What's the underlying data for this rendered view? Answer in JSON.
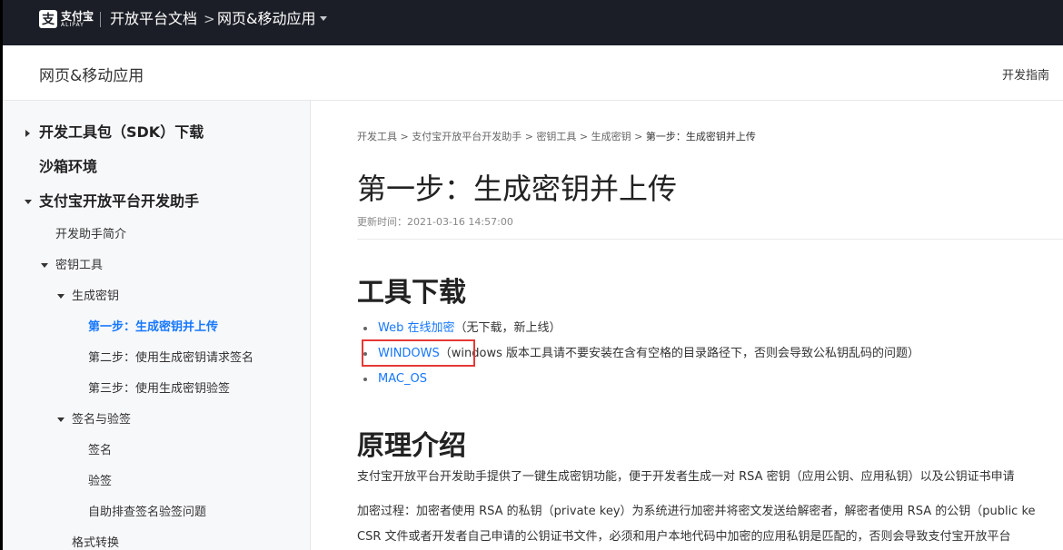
{
  "topbar": {
    "logo_cn": "支付宝",
    "logo_en": "ALIPAY",
    "logo_glyph": "支",
    "title": "开放平台文档",
    "arrow": ">",
    "app": "网页&移动应用"
  },
  "subheader": {
    "title": "网页&移动应用",
    "guide": "开发指南"
  },
  "sidebar": {
    "items": [
      {
        "label": "开发工具包（SDK）下载"
      },
      {
        "label": "沙箱环境"
      },
      {
        "label": "支付宝开放平台开发助手"
      },
      {
        "label": "开发助手简介"
      },
      {
        "label": "密钥工具"
      },
      {
        "label": "生成密钥"
      },
      {
        "label": "第一步：生成密钥并上传"
      },
      {
        "label": "第二步：使用生成密钥请求签名"
      },
      {
        "label": "第三步：使用生成密钥验签"
      },
      {
        "label": "签名与验签"
      },
      {
        "label": "签名"
      },
      {
        "label": "验签"
      },
      {
        "label": "自助排查签名验签问题"
      },
      {
        "label": "格式转换"
      }
    ]
  },
  "main": {
    "breadcrumb": {
      "items": [
        "开发工具",
        "支付宝开放平台开发助手",
        "密钥工具",
        "生成密钥"
      ],
      "sep": " > ",
      "current": "第一步：生成密钥并上传"
    },
    "title": "第一步：生成密钥并上传",
    "updated": "更新时间：2021-03-16 14:57:00",
    "section_tools": "工具下载",
    "downloads": [
      {
        "link": "Web 在线加密",
        "note": "（无下载，新上线）"
      },
      {
        "link": "WINDOWS",
        "note": "（windows 版本工具请不要安装在含有空格的目录路径下，否则会导致公私钥乱码的问题）"
      },
      {
        "link": "MAC_OS",
        "note": ""
      }
    ],
    "section_principle": "原理介绍",
    "paragraphs": [
      "支付宝开放平台开发助手提供了一键生成密钥功能，便于开发者生成一对 RSA 密钥（应用公钥、应用私钥）以及公钥证书申请",
      "加密过程：加密者使用 RSA 的私钥（private key）为系统进行加密并将密文发送给解密者，解密者使用 RSA 的公钥（public ke",
      "CSR 文件或者开发者自己申请的公钥证书文件，必须和用户本地代码中加密的应用私钥是匹配的，否则会导致支付宝开放平台"
    ]
  }
}
